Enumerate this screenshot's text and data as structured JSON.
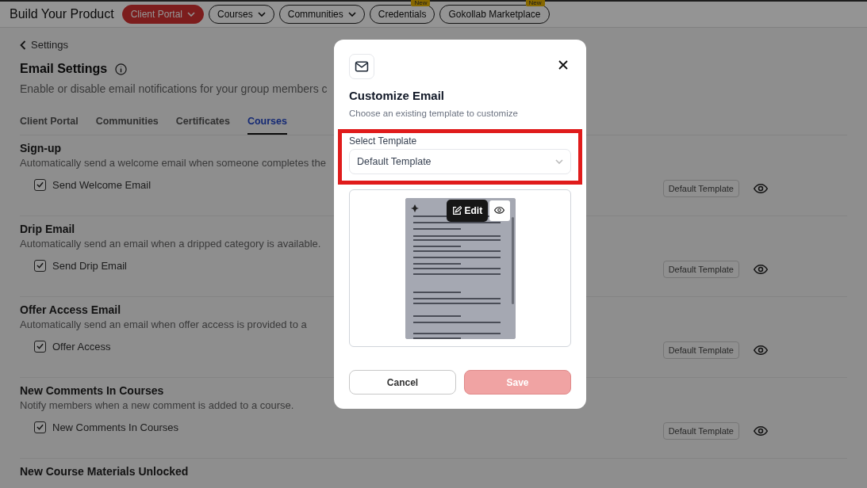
{
  "header": {
    "title": "Build Your Product",
    "nav": [
      {
        "label": "Client Portal",
        "selected": true,
        "dropdown": true
      },
      {
        "label": "Courses",
        "selected": false,
        "dropdown": true
      },
      {
        "label": "Communities",
        "selected": false,
        "dropdown": true
      },
      {
        "label": "Credentials",
        "selected": false,
        "dropdown": false,
        "badge": "New"
      },
      {
        "label": "Gokollab Marketplace",
        "selected": false,
        "dropdown": false,
        "badge": "New"
      }
    ]
  },
  "back_link": "Settings",
  "page_title": "Email Settings",
  "page_subtitle": "Enable or disable email notifications for your group members c",
  "tabs": [
    {
      "label": "Client Portal",
      "selected": false
    },
    {
      "label": "Communities",
      "selected": false
    },
    {
      "label": "Certificates",
      "selected": false
    },
    {
      "label": "Courses",
      "selected": true
    }
  ],
  "sections": [
    {
      "title": "Sign-up",
      "description": "Automatically send a welcome email when someone completes the",
      "option": {
        "label": "Send Welcome Email",
        "checked": true
      },
      "template_button": "Default Template"
    },
    {
      "title": "Drip Email",
      "description": "Automatically send an email when a dripped category is available.",
      "option": {
        "label": "Send Drip Email",
        "checked": true
      },
      "template_button": "Default Template"
    },
    {
      "title": "Offer Access Email",
      "description": "Automatically send an email when offer access is provided to a",
      "option": {
        "label": "Offer Access",
        "checked": true
      },
      "template_button": "Default Template"
    },
    {
      "title": "New Comments In Courses",
      "description": "Notify members when a new comment is added to a course.",
      "option": {
        "label": "New Comments In Courses",
        "checked": true
      },
      "template_button": "Default Template"
    },
    {
      "title": "New Course Materials Unlocked"
    }
  ],
  "modal": {
    "title": "Customize Email",
    "subtitle": "Choose an existing template to customize",
    "field_label": "Select Template",
    "select_value": "Default Template",
    "preview": {
      "edit_label": "Edit"
    },
    "cancel": "Cancel",
    "save": {
      "label": "Save",
      "disabled": true
    }
  }
}
